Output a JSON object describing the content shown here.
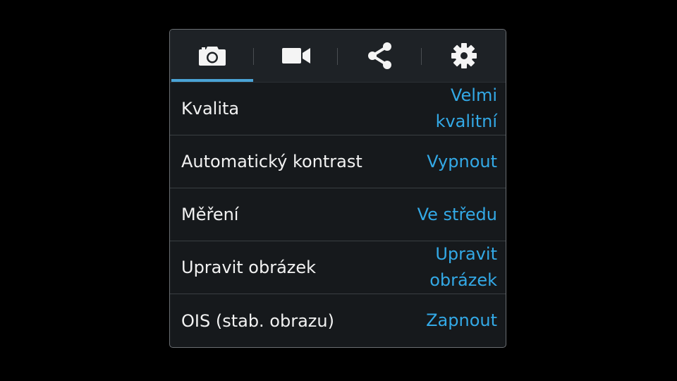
{
  "colors": {
    "background": "#000000",
    "panel": "#16191c",
    "accent": "#4aa3d6",
    "value_text": "#33a9e6",
    "label_text": "#f2f2f2"
  },
  "tabs": [
    {
      "icon": "camera-icon",
      "active": true
    },
    {
      "icon": "video-camera-icon",
      "active": false
    },
    {
      "icon": "share-icon",
      "active": false
    },
    {
      "icon": "gear-icon",
      "active": false
    }
  ],
  "settings": [
    {
      "label": "Kvalita",
      "value": "Velmi kvalitní"
    },
    {
      "label": "Automatický kontrast",
      "value": "Vypnout"
    },
    {
      "label": "Měření",
      "value": "Ve středu"
    },
    {
      "label": "Upravit obrázek",
      "value": "Upravit obrázek"
    },
    {
      "label": "OIS (stab. obrazu)",
      "value": "Zapnout"
    }
  ]
}
